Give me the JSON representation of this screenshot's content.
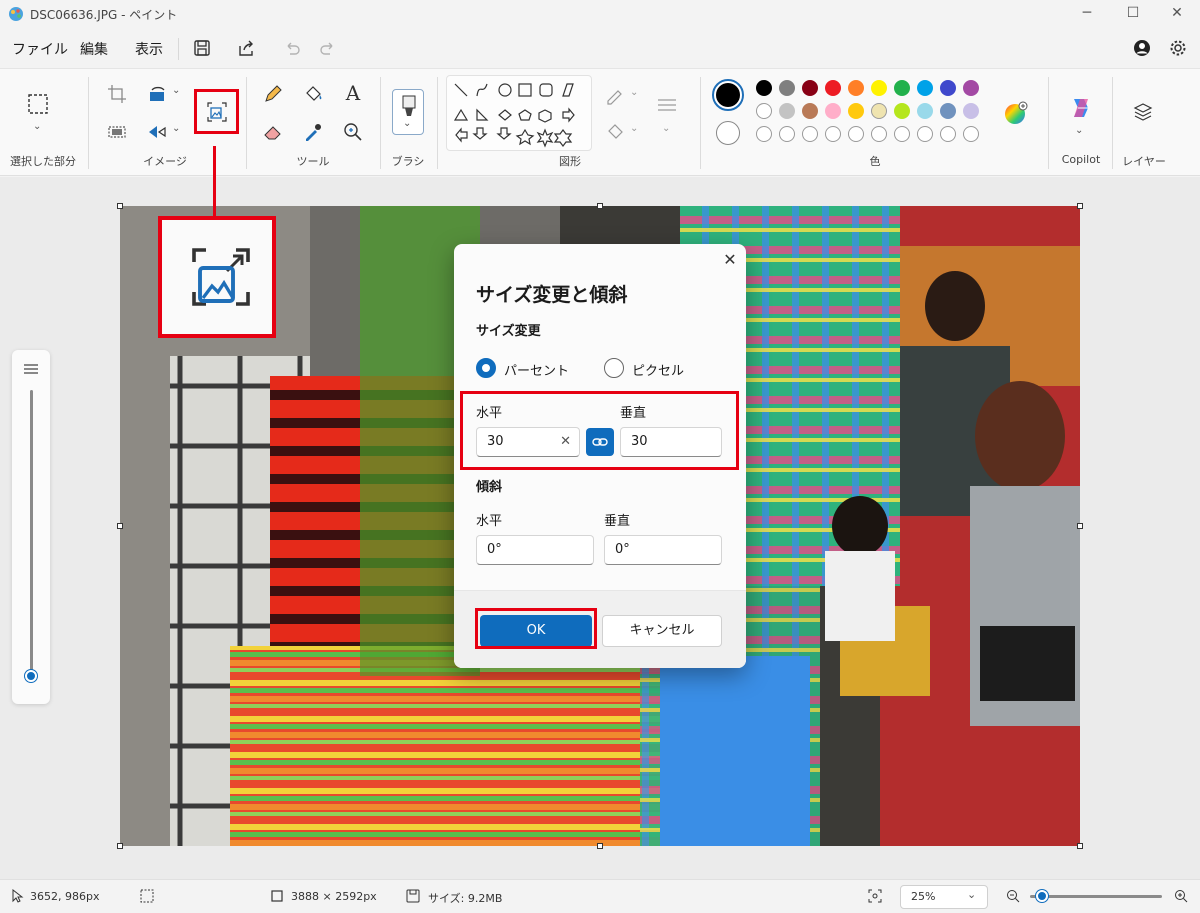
{
  "window": {
    "title": "DSC06636.JPG - ペイント"
  },
  "menu": {
    "file": "ファイル",
    "edit": "編集",
    "view": "表示"
  },
  "ribbon": {
    "groups": {
      "selection": "選択した部分",
      "image": "イメージ",
      "tools": "ツール",
      "brush": "ブラシ",
      "shapes": "図形",
      "colors": "色",
      "copilot": "Copilot",
      "layers": "レイヤー"
    },
    "text_tool": "A",
    "palette": {
      "row1": [
        "#000000",
        "#7f7f7f",
        "#880015",
        "#ed1c24",
        "#ff7f27",
        "#fff200",
        "#22b14c",
        "#00a2e8",
        "#3f48cc",
        "#a349a4"
      ],
      "row2": [
        "#ffffff",
        "#c3c3c3",
        "#b97a57",
        "#ffaec9",
        "#ffc90e",
        "#efe4b0",
        "#b5e61d",
        "#99d9ea",
        "#7092be",
        "#c8bfe7"
      ],
      "primary": "#000000",
      "secondary": "#ffffff"
    }
  },
  "dialog": {
    "title": "サイズ変更と傾斜",
    "resize_section": "サイズ変更",
    "percent_label": "パーセント",
    "pixel_label": "ピクセル",
    "horizontal_label": "水平",
    "vertical_label": "垂直",
    "resize_horizontal": "30",
    "resize_vertical": "30",
    "skew_section": "傾斜",
    "skew_horizontal_label": "水平",
    "skew_vertical_label": "垂直",
    "skew_horizontal": "0°",
    "skew_vertical": "0°",
    "ok": "OK",
    "cancel": "キャンセル"
  },
  "status": {
    "cursor_pos": "3652, 986px",
    "image_size": "3888 × 2592px",
    "file_size": "サイズ: 9.2MB",
    "zoom": "25%"
  },
  "colors": {
    "accent": "#0f6cbd",
    "highlight": "#e60012"
  }
}
